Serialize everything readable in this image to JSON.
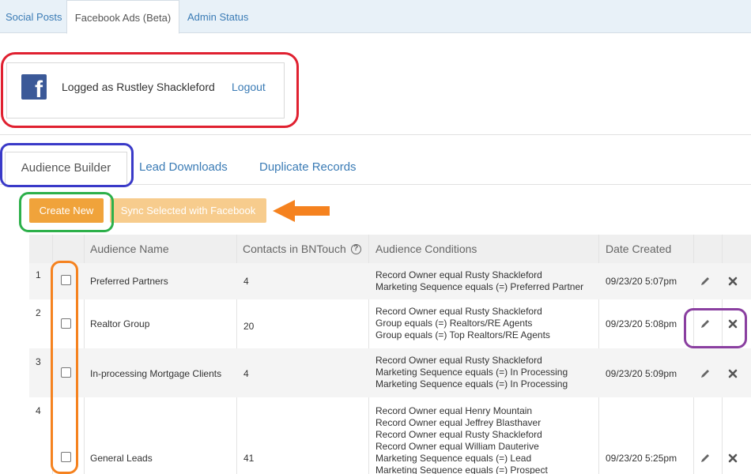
{
  "top_tabs": [
    {
      "label": "Social Posts"
    },
    {
      "label": "Facebook Ads (Beta)"
    },
    {
      "label": "Admin Status"
    }
  ],
  "facebook": {
    "logged_text": "Logged as Rustley Shackleford",
    "logout_label": "Logout"
  },
  "sub_tabs": [
    {
      "label": "Audience Builder"
    },
    {
      "label": "Lead Downloads"
    },
    {
      "label": "Duplicate Records"
    }
  ],
  "buttons": {
    "create_new": "Create New",
    "sync_selected": "Sync Selected with Facebook"
  },
  "table": {
    "headers": {
      "audience_name": "Audience Name",
      "contacts": "Contacts in BNTouch",
      "conditions": "Audience Conditions",
      "date_created": "Date Created"
    },
    "rows": [
      {
        "num": "1",
        "name": "Preferred Partners",
        "contacts": "4",
        "conditions": [
          "Record Owner equal Rusty Shackleford",
          "Marketing Sequence equals (=) Preferred Partner"
        ],
        "date": "09/23/20 5:07pm"
      },
      {
        "num": "2",
        "name": "Realtor Group",
        "contacts": "20",
        "conditions": [
          "Record Owner equal Rusty Shackleford",
          "Group equals (=) Realtors/RE Agents",
          "Group equals (=) Top Realtors/RE Agents"
        ],
        "date": "09/23/20 5:08pm"
      },
      {
        "num": "3",
        "name": "In-processing Mortgage Clients",
        "contacts": "4",
        "conditions": [
          "Record Owner equal Rusty Shackleford",
          "Marketing Sequence equals (=) In Processing",
          "Marketing Sequence equals (=) In Processing"
        ],
        "date": "09/23/20 5:09pm"
      },
      {
        "num": "4",
        "name": "General Leads",
        "contacts": "41",
        "conditions": [
          "Record Owner equal Henry Mountain",
          "Record Owner equal Jeffrey Blasthaver",
          "Record Owner equal Rusty Shackleford",
          "Record Owner equal William Dauterive",
          "Marketing Sequence equals (=) Lead",
          "Marketing Sequence equals (=) Prospect"
        ],
        "date": "09/23/20 5:25pm"
      }
    ]
  },
  "colors": {
    "link": "#3a7bb5",
    "create_button": "#f0a33b",
    "sync_button": "#f7cc8d",
    "facebook": "#3b5998",
    "annotation_red": "#e02030",
    "annotation_blue": "#3a3ac8",
    "annotation_green": "#2db04a",
    "annotation_orange": "#f5821f",
    "annotation_purple": "#8a3fa0"
  },
  "icons": {
    "facebook": "facebook-logo-icon",
    "help": "help-circle-icon",
    "edit": "pencil-icon",
    "delete": "close-icon",
    "arrow": "arrow-left-icon"
  }
}
